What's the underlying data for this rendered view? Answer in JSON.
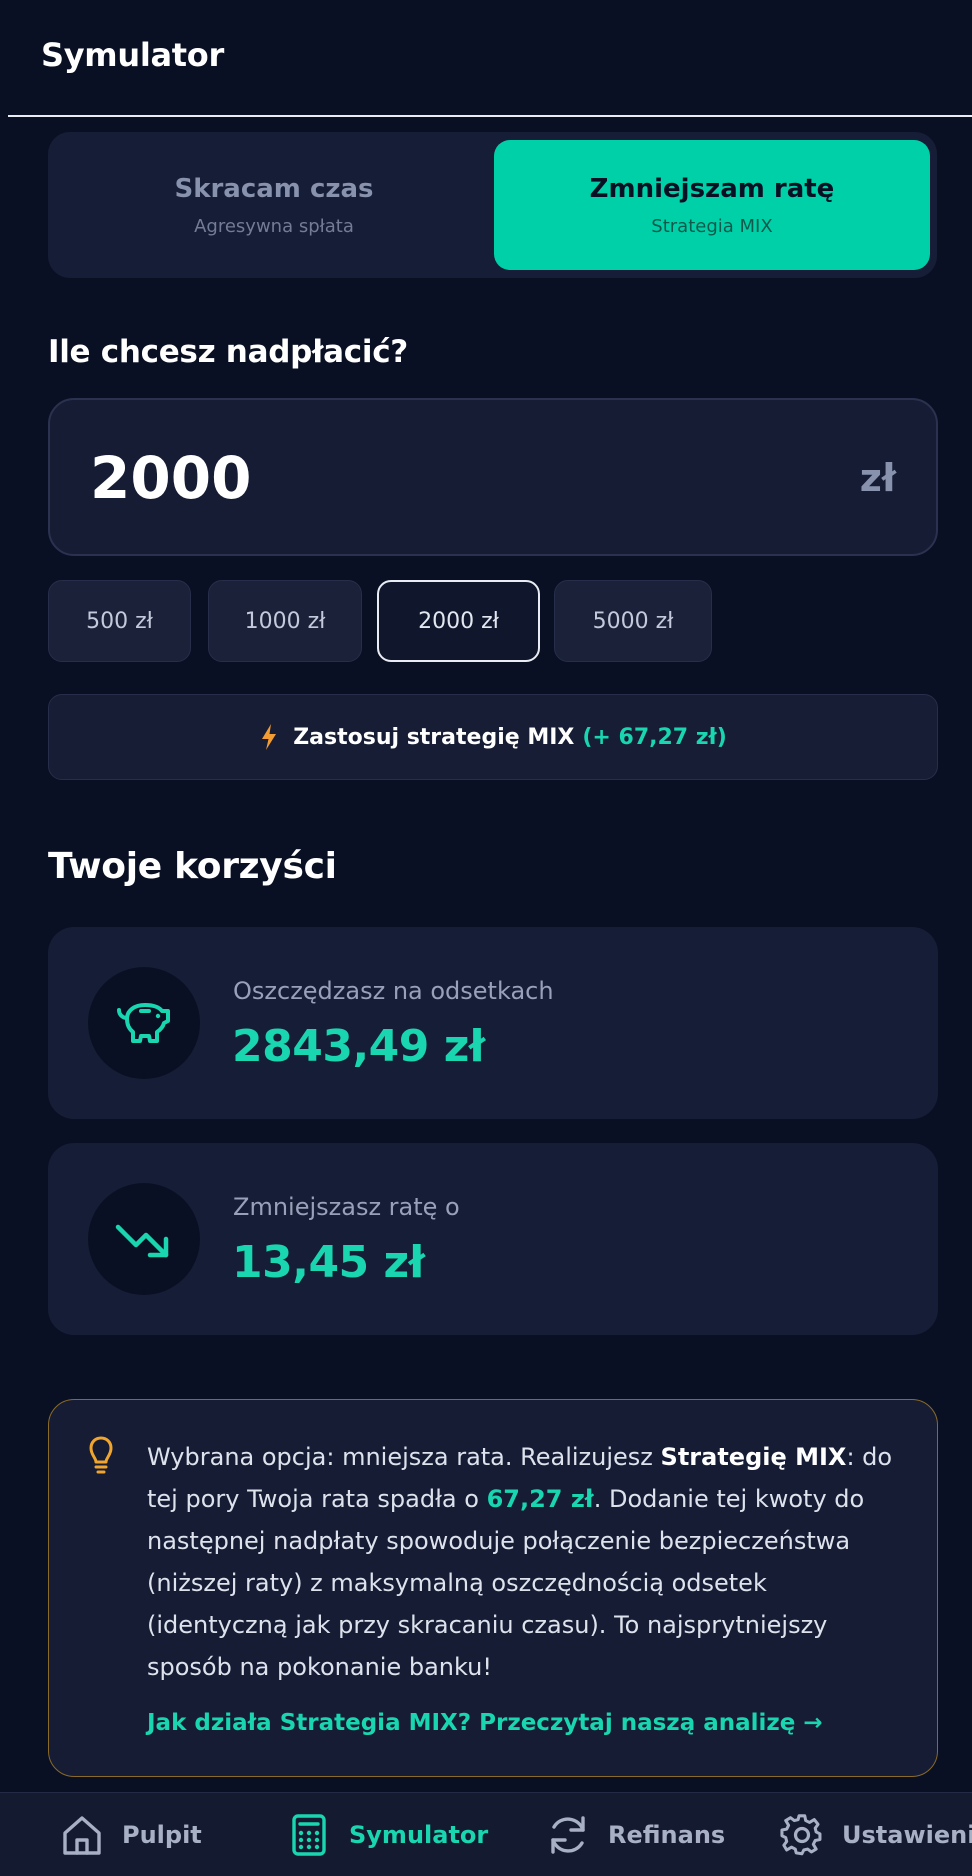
{
  "header": {
    "title": "Symulator"
  },
  "mode_toggle": {
    "options": [
      {
        "title": "Skracam czas",
        "subtitle": "Agresywna spłata"
      },
      {
        "title": "Zmniejszam ratę",
        "subtitle": "Strategia MIX"
      }
    ],
    "selected": "Zmniejszam ratę",
    "accent_color": "#00d0a7"
  },
  "overpayment": {
    "question": "Ile chcesz nadpłacić?",
    "amount_value": "2000",
    "currency": "zł",
    "quick_amounts": [
      "500 zł",
      "1000 zł",
      "2000 zł",
      "5000 zł"
    ],
    "selected_quick_amount": "2000 zł"
  },
  "strategy_button": {
    "icon": "lightning-icon",
    "label": "Zastosuj strategię MIX",
    "amount": "(+ 67,27 zł)"
  },
  "benefits": {
    "heading": "Twoje korzyści",
    "cards": [
      {
        "icon": "piggy-bank-icon",
        "label": "Oszczędzasz na odsetkach",
        "value": "2843,49 zł"
      },
      {
        "icon": "trending-down-icon",
        "label": "Zmniejszasz ratę o",
        "value": "13,45 zł"
      }
    ]
  },
  "info_box": {
    "icon": "lightbulb-icon",
    "text_1": "Wybrana opcja: mniejsza rata. Realizujesz ",
    "text_bold": "Strategię MIX",
    "text_2": ": do tej pory Twoja rata spadła o ",
    "text_amount": "67,27 zł",
    "text_3": ". Dodanie tej kwoty do następnej nadpłaty spowoduje połączenie bezpieczeństwa (niższej raty) z maksymalną oszczędnością odsetek (identyczną jak przy skracaniu czasu). To najsprytniejszy sposób na pokonanie banku!",
    "link": "Jak działa Strategia MIX? Przeczytaj naszą analizę →",
    "border_color": "#8a6a28"
  },
  "bottom_nav": {
    "items": [
      {
        "label": "Pulpit",
        "icon": "home-icon"
      },
      {
        "label": "Symulator",
        "icon": "calculator-icon"
      },
      {
        "label": "Refinans",
        "icon": "refresh-icon"
      },
      {
        "label": "Ustawienia",
        "icon": "gear-icon"
      }
    ],
    "active": "Symulator",
    "active_color": "#19d6b0"
  }
}
